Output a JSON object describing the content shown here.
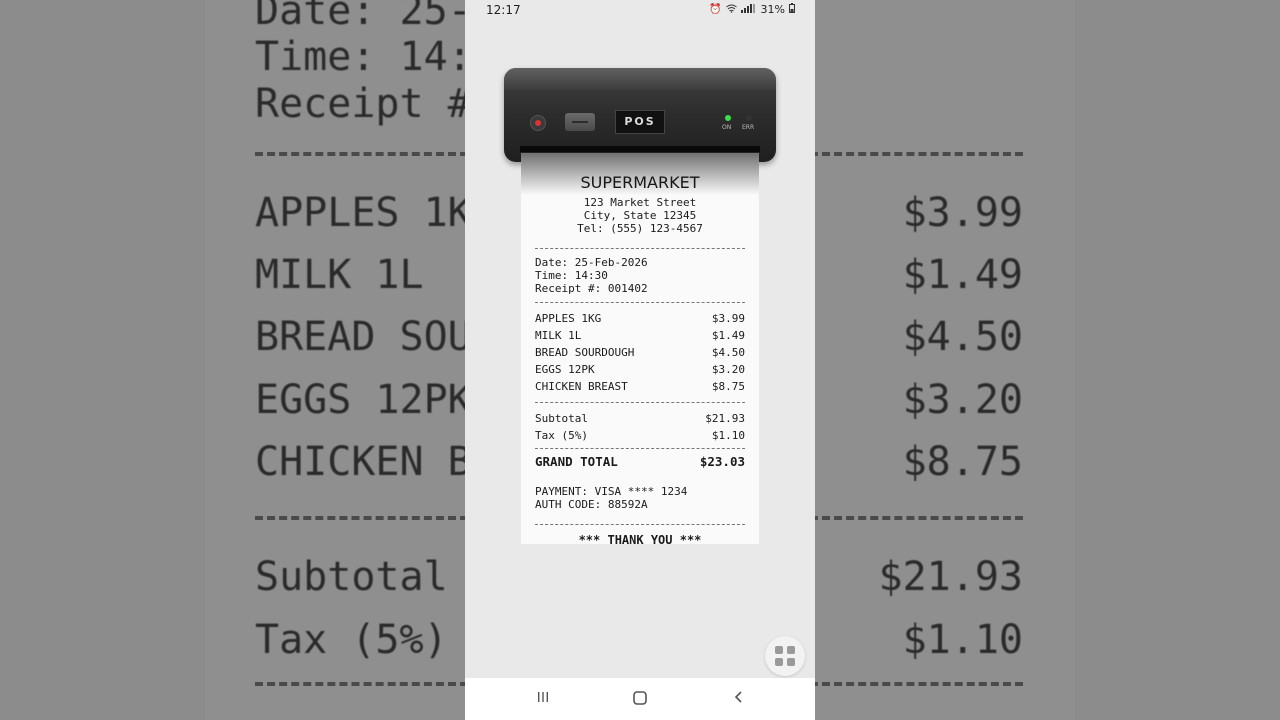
{
  "status_bar": {
    "time": "12:17",
    "battery": "31%"
  },
  "printer": {
    "label": "POS",
    "led_on": "ON",
    "led_err": "ERR"
  },
  "receipt": {
    "store": "SUPERMARKET",
    "address1": "123 Market Street",
    "address2": "City, State 12345",
    "phone": "Tel: (555) 123-4567",
    "date": "Date: 25-Feb-2026",
    "time": "Time: 14:30",
    "receipt_no": "Receipt #: 001402",
    "items": [
      {
        "name": "APPLES 1KG",
        "price": "$3.99"
      },
      {
        "name": "MILK 1L",
        "price": "$1.49"
      },
      {
        "name": "BREAD SOURDOUGH",
        "price": "$4.50"
      },
      {
        "name": "EGGS 12PK",
        "price": "$3.20"
      },
      {
        "name": "CHICKEN BREAST",
        "price": "$8.75"
      }
    ],
    "subtotal_label": "Subtotal",
    "subtotal": "$21.93",
    "tax_label": "Tax (5%)",
    "tax": "$1.10",
    "total_label": "GRAND TOTAL",
    "total": "$23.03",
    "payment": "PAYMENT: VISA **** 1234",
    "auth": "AUTH CODE: 88592A",
    "thanks": "*** THANK YOU ***"
  },
  "background": {
    "lines": [
      "Date: 25-",
      "Time: 14:",
      "Receipt #"
    ],
    "items": [
      {
        "name": "APPLES 1K",
        "price": "$3.99"
      },
      {
        "name": "MILK 1L",
        "price": "$1.49"
      },
      {
        "name": "BREAD SOU",
        "price": "$4.50"
      },
      {
        "name": "EGGS 12PK",
        "price": "$3.20"
      },
      {
        "name": "CHICKEN B",
        "price": "$8.75"
      }
    ],
    "subtotal_label": "Subtotal",
    "subtotal": "$21.93",
    "tax_label": "Tax (5%)",
    "tax": "$1.10"
  },
  "icons": {
    "status_right": [
      "alarm-icon",
      "wifi-icon",
      "signal-icon",
      "battery-icon"
    ],
    "fab": "grid-icon",
    "nav": [
      "recents-icon",
      "home-icon",
      "back-icon"
    ]
  }
}
